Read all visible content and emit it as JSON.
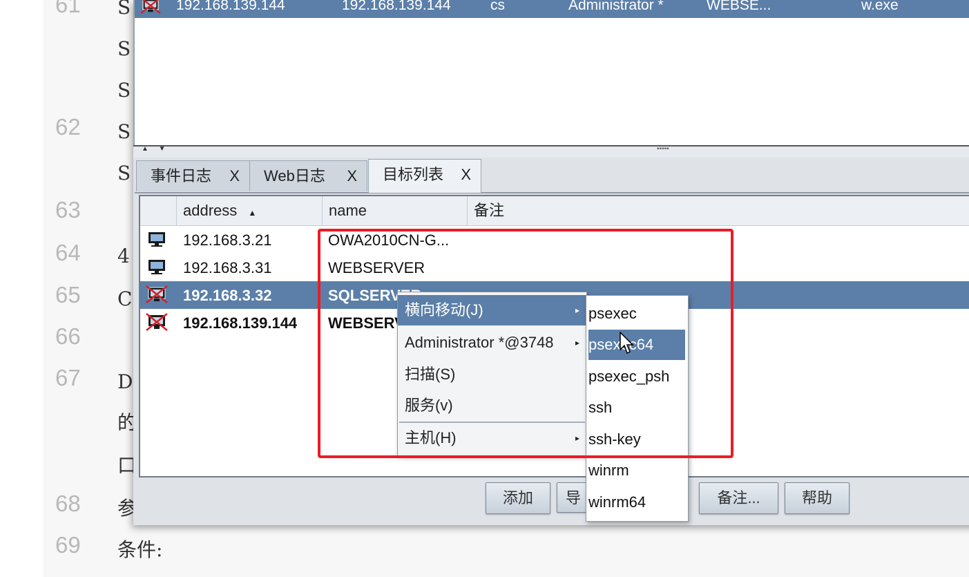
{
  "editor": {
    "lines": [
      {
        "num": "61",
        "text": "S"
      },
      {
        "num": "",
        "text": "S"
      },
      {
        "num": "",
        "text": "S"
      },
      {
        "num": "62",
        "text": "S"
      },
      {
        "num": "",
        "text": "S"
      },
      {
        "num": "63",
        "text": ""
      },
      {
        "num": "64",
        "text": "4"
      },
      {
        "num": "65",
        "text": "C"
      },
      {
        "num": "66",
        "text": ""
      },
      {
        "num": "67",
        "text": "D"
      },
      {
        "num": "",
        "text": "的"
      },
      {
        "num": "",
        "text": "口"
      },
      {
        "num": "68",
        "text": "参"
      },
      {
        "num": "69",
        "text": "条件:"
      }
    ]
  },
  "top_pane": {
    "row": {
      "external": "192.168.139.144",
      "internal": "192.168.139.144",
      "listener": "cs",
      "user": "Administrator *",
      "computer": "WEBSE...",
      "process": "w.exe"
    }
  },
  "tabs": [
    {
      "label": "事件日志",
      "close": "X"
    },
    {
      "label": "Web日志",
      "close": "X"
    },
    {
      "label": "目标列表",
      "close": "X"
    }
  ],
  "table": {
    "columns": [
      "address",
      "name",
      "备注"
    ],
    "sort_indicator": "▲",
    "rows": [
      {
        "address": "192.168.3.21",
        "name": "OWA2010CN-G...",
        "note": ""
      },
      {
        "address": "192.168.3.31",
        "name": "WEBSERVER",
        "note": ""
      },
      {
        "address": "192.168.3.32",
        "name": "SQLSERVER",
        "note": ""
      },
      {
        "address": "192.168.139.144",
        "name": "WEBSERVER",
        "note": ""
      }
    ]
  },
  "context_menu": {
    "items": [
      {
        "label": "横向移动(J)",
        "submenu": true
      },
      {
        "label": "Administrator *@3748",
        "submenu": true
      },
      {
        "label": "扫描(S)",
        "submenu": false
      },
      {
        "label": "服务(v)",
        "submenu": false
      },
      {
        "label": "主机(H)",
        "submenu": true
      }
    ]
  },
  "submenu": {
    "items": [
      "psexec",
      "psexec64",
      "psexec_psh",
      "ssh",
      "ssh-key",
      "winrm",
      "winrm64"
    ],
    "highlighted": "psexec64"
  },
  "buttons": [
    "添加",
    "导",
    "备注...",
    "帮助"
  ],
  "colors": {
    "selection": "#5b7fa8",
    "highlight_box": "#ec1c24"
  }
}
